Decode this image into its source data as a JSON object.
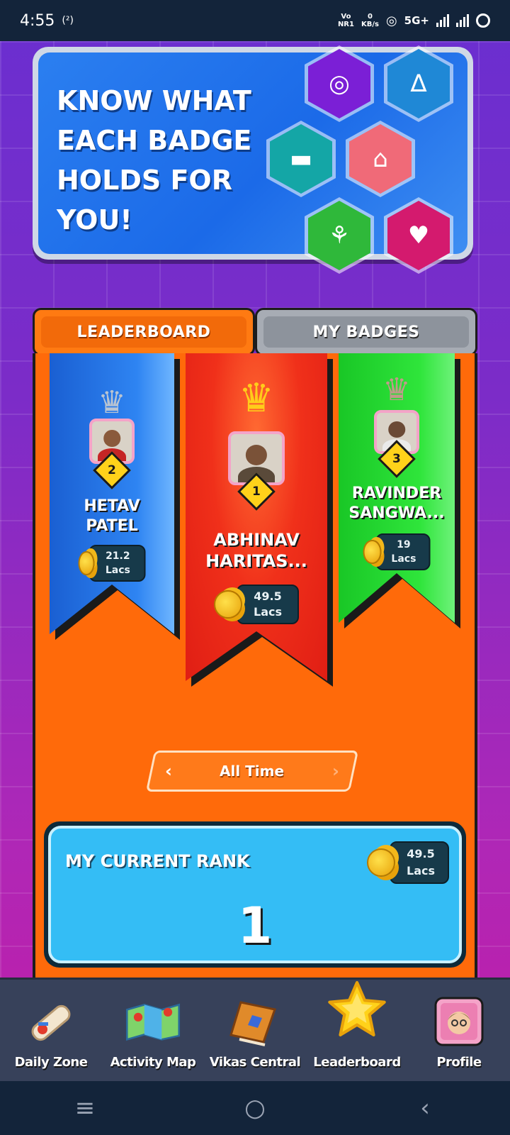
{
  "status_bar": {
    "time": "4:55",
    "hotspot": "(²)",
    "volte_top": "Vo",
    "volte_bottom": "NR1",
    "speed_value": "0",
    "speed_unit": "KB/s",
    "network": "5G+"
  },
  "banner": {
    "headline": "KNOW WHAT EACH BADGE HOLDS FOR YOU!",
    "badges": [
      {
        "icon": "globe-icon",
        "glyph": "◎",
        "color": "#7b1fd6"
      },
      {
        "icon": "water-tap-icon",
        "glyph": "∆",
        "color": "#1f88d6"
      },
      {
        "icon": "train-icon",
        "glyph": "▬",
        "color": "#14a6a6"
      },
      {
        "icon": "school-icon",
        "glyph": "⌂",
        "color": "#f06a78"
      },
      {
        "icon": "agriculture-icon",
        "glyph": "⚘",
        "color": "#2fb83a"
      },
      {
        "icon": "health-icon",
        "glyph": "♥",
        "color": "#d41a6e"
      }
    ]
  },
  "tabs": {
    "leaderboard": "LEADERBOARD",
    "my_badges": "MY BADGES"
  },
  "podium": {
    "first": {
      "rank": "1",
      "name": "ABHINAV\nHARITAS...",
      "amount_line1": "49.5",
      "amount_line2": "Lacs"
    },
    "second": {
      "rank": "2",
      "name": "HETAV\nPATEL",
      "amount": "21.2 Lacs"
    },
    "third": {
      "rank": "3",
      "name": "RAVINDER\nSANGWA...",
      "amount": "19 Lacs"
    }
  },
  "time_filter": {
    "label": "All Time",
    "prev": "‹",
    "next": "›"
  },
  "current_rank": {
    "title": "MY CURRENT RANK",
    "rank": "1",
    "amount_line1": "49.5",
    "amount_line2": "Lacs"
  },
  "bottom_nav": {
    "items": [
      {
        "label": "Daily Zone",
        "icon": "scroll-icon"
      },
      {
        "label": "Activity Map",
        "icon": "map-icon"
      },
      {
        "label": "Vikas Central",
        "icon": "book-icon"
      },
      {
        "label": "Leaderboard",
        "icon": "star-icon"
      },
      {
        "label": "Profile",
        "icon": "avatar-icon"
      }
    ],
    "active": "Leaderboard"
  },
  "colors": {
    "ribbon_second": "#1f6fe6",
    "ribbon_first": "#f0301a",
    "ribbon_third": "#1ed82a",
    "board_orange": "#ff6a0a"
  }
}
